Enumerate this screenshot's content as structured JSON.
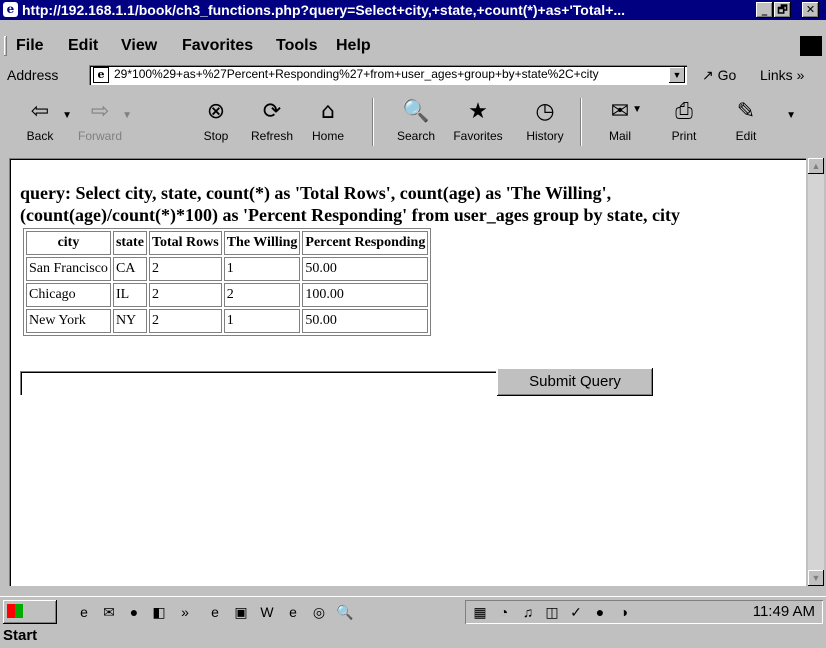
{
  "window": {
    "title": "http://192.168.1.1/book/ch3_functions.php?query=Select+city,+state,+count(*)+as+'Total+...",
    "controls": {
      "minimize": "_",
      "maximize": "🗗",
      "close": "✕"
    }
  },
  "menu": [
    "File",
    "Edit",
    "View",
    "Favorites",
    "Tools",
    "Help"
  ],
  "address": {
    "label": "Address",
    "url": "29*100%29+as+%27Percent+Responding%27+from+user_ages+group+by+state%2C+city",
    "go_label": "Go",
    "links_label": "Links »"
  },
  "toolbar": {
    "back": "Back",
    "forward": "Forward",
    "stop": "Stop",
    "refresh": "Refresh",
    "home": "Home",
    "search": "Search",
    "favorites": "Favorites",
    "history": "History",
    "mail": "Mail",
    "print": "Print",
    "edit": "Edit"
  },
  "page": {
    "query_text": "query: Select city, state, count(*) as 'Total Rows', count(age) as 'The Willing', (count(age)/count(*)*100) as 'Percent Responding' from user_ages group by state, city",
    "table": {
      "headers": [
        "city",
        "state",
        "Total Rows",
        "The Willing",
        "Percent Responding"
      ],
      "rows": [
        [
          "San Francisco",
          "CA",
          "2",
          "1",
          "50.00"
        ],
        [
          "Chicago",
          "IL",
          "2",
          "2",
          "100.00"
        ],
        [
          "New York",
          "NY",
          "2",
          "1",
          "50.00"
        ]
      ]
    },
    "input_value": "",
    "submit_label": "Submit Query"
  },
  "taskbar": {
    "start_label": "Start",
    "clock": "11:49 AM"
  }
}
